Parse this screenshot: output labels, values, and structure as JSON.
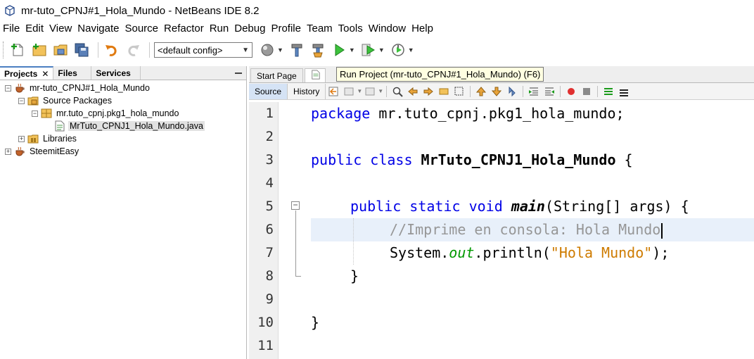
{
  "window": {
    "title": "mr-tuto_CPNJ#1_Hola_Mundo - NetBeans IDE 8.2"
  },
  "menu": [
    "File",
    "Edit",
    "View",
    "Navigate",
    "Source",
    "Refactor",
    "Run",
    "Debug",
    "Profile",
    "Team",
    "Tools",
    "Window",
    "Help"
  ],
  "toolbar": {
    "config": "<default config>",
    "icons": [
      "new-file-icon",
      "new-project-icon",
      "open-project-icon",
      "save-all-icon",
      "undo-icon",
      "redo-icon",
      "web-browser-icon",
      "build-hammer-icon",
      "clean-build-icon",
      "run-project-icon",
      "debug-project-icon",
      "profile-project-icon"
    ]
  },
  "left_panel": {
    "tabs": [
      "Projects",
      "Files",
      "Services"
    ],
    "tree": [
      {
        "label": "mr-tuto_CPNJ#1_Hola_Mundo",
        "icon": "coffee-cup-icon",
        "level": 0,
        "toggle": "-"
      },
      {
        "label": "Source Packages",
        "icon": "source-folder-icon",
        "level": 1,
        "toggle": "-"
      },
      {
        "label": "mr.tuto_cpnj.pkg1_hola_mundo",
        "icon": "package-icon",
        "level": 2,
        "toggle": "-"
      },
      {
        "label": "MrTuto_CPNJ1_Hola_Mundo.java",
        "icon": "java-file-icon",
        "level": 3,
        "toggle": "",
        "selected": true
      },
      {
        "label": "Libraries",
        "icon": "library-icon",
        "level": 1,
        "toggle": "+"
      },
      {
        "label": "SteemitEasy",
        "icon": "coffee-cup-icon",
        "level": 0,
        "toggle": "+"
      }
    ]
  },
  "editor": {
    "tabs": [
      "Start Page",
      ""
    ],
    "tooltip": "Run Project (mr-tuto_CPNJ#1_Hola_Mundo) (F6)",
    "source_tab": "Source",
    "history_tab": "History",
    "line_numbers": [
      "1",
      "2",
      "3",
      "4",
      "5",
      "6",
      "7",
      "8",
      "9",
      "10",
      "11"
    ],
    "code": {
      "l1_kw": "package",
      "l1_rest": " mr.tuto_cpnj.pkg1_hola_mundo;",
      "l3_kw": "public class",
      "l3_name": "MrTuto_CPNJ1_Hola_Mundo",
      "l3_rest": " {",
      "l5_kw": "public static void",
      "l5_name": "main",
      "l5_rest": "(String[] args) {",
      "l6_comment": "//Imprime en consola: Hola Mundo",
      "l7_a": "System.",
      "l7_field": "out",
      "l7_b": ".println(",
      "l7_str": "\"Hola Mundo\"",
      "l7_c": ");",
      "l8": "}",
      "l10": "}"
    }
  },
  "colors": {
    "keyword": "#0000e6",
    "string": "#ce7b00",
    "comment": "#969696",
    "field": "#009900",
    "highlight": "#e8f0fa"
  }
}
